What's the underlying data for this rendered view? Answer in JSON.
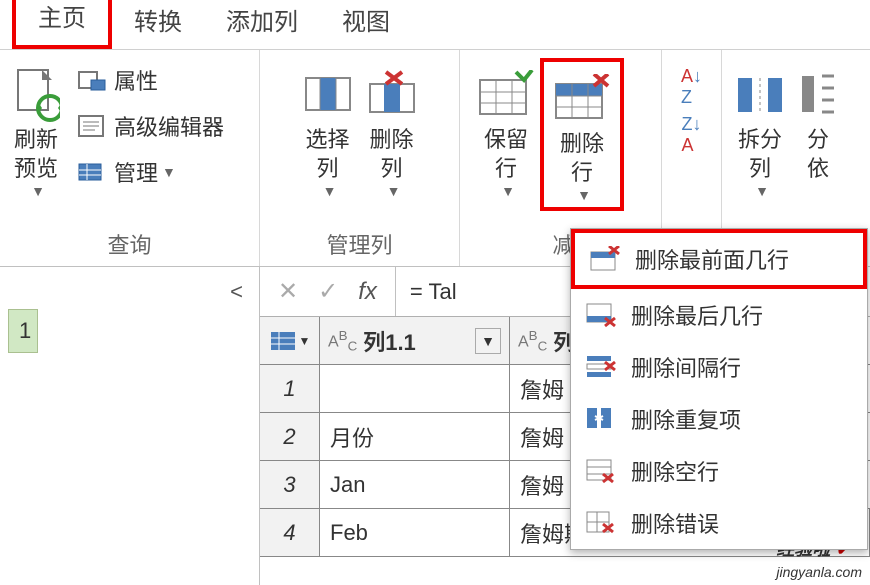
{
  "tabs": {
    "home": "主页",
    "transform": "转换",
    "add_column": "添加列",
    "view": "视图"
  },
  "ribbon": {
    "query_group": {
      "label": "查询",
      "refresh_preview": "刷新\n预览",
      "properties": "属性",
      "advanced_editor": "高级编辑器",
      "manage": "管理"
    },
    "manage_cols_group": {
      "label": "管理列",
      "choose_cols": "选择\n列",
      "remove_cols": "删除\n列"
    },
    "reduce_rows_group": {
      "label": "减",
      "keep_rows": "保留\n行",
      "remove_rows": "删除\n行"
    },
    "sort_group": {
      "label": "",
      "az": "A↓Z",
      "za": "Z↓A"
    },
    "split_group": {
      "split_col": "拆分\n列",
      "by": "分\n依"
    }
  },
  "remove_rows_menu": {
    "remove_top": "删除最前面几行",
    "remove_bottom": "删除最后几行",
    "remove_alternate": "删除间隔行",
    "remove_duplicates": "删除重复项",
    "remove_blank": "删除空行",
    "remove_errors": "删除错误"
  },
  "sidebar": {
    "query_item": "1"
  },
  "formula_bar": {
    "cancel": "✕",
    "confirm": "✓",
    "fx": "fx",
    "value": "= Tal"
  },
  "grid": {
    "col1_header": "列1.1",
    "col2_header": "列",
    "abc": "ABC",
    "rows": [
      {
        "n": "1",
        "c1": "",
        "c2": "詹姆"
      },
      {
        "n": "2",
        "c1": "月份",
        "c2": "詹姆"
      },
      {
        "n": "3",
        "c1": "Jan",
        "c2": "詹姆"
      },
      {
        "n": "4",
        "c1": "Feb",
        "c2": "詹姆斯下士头条 @Ex"
      }
    ]
  },
  "watermark": "经验啦\njingyanla.com"
}
